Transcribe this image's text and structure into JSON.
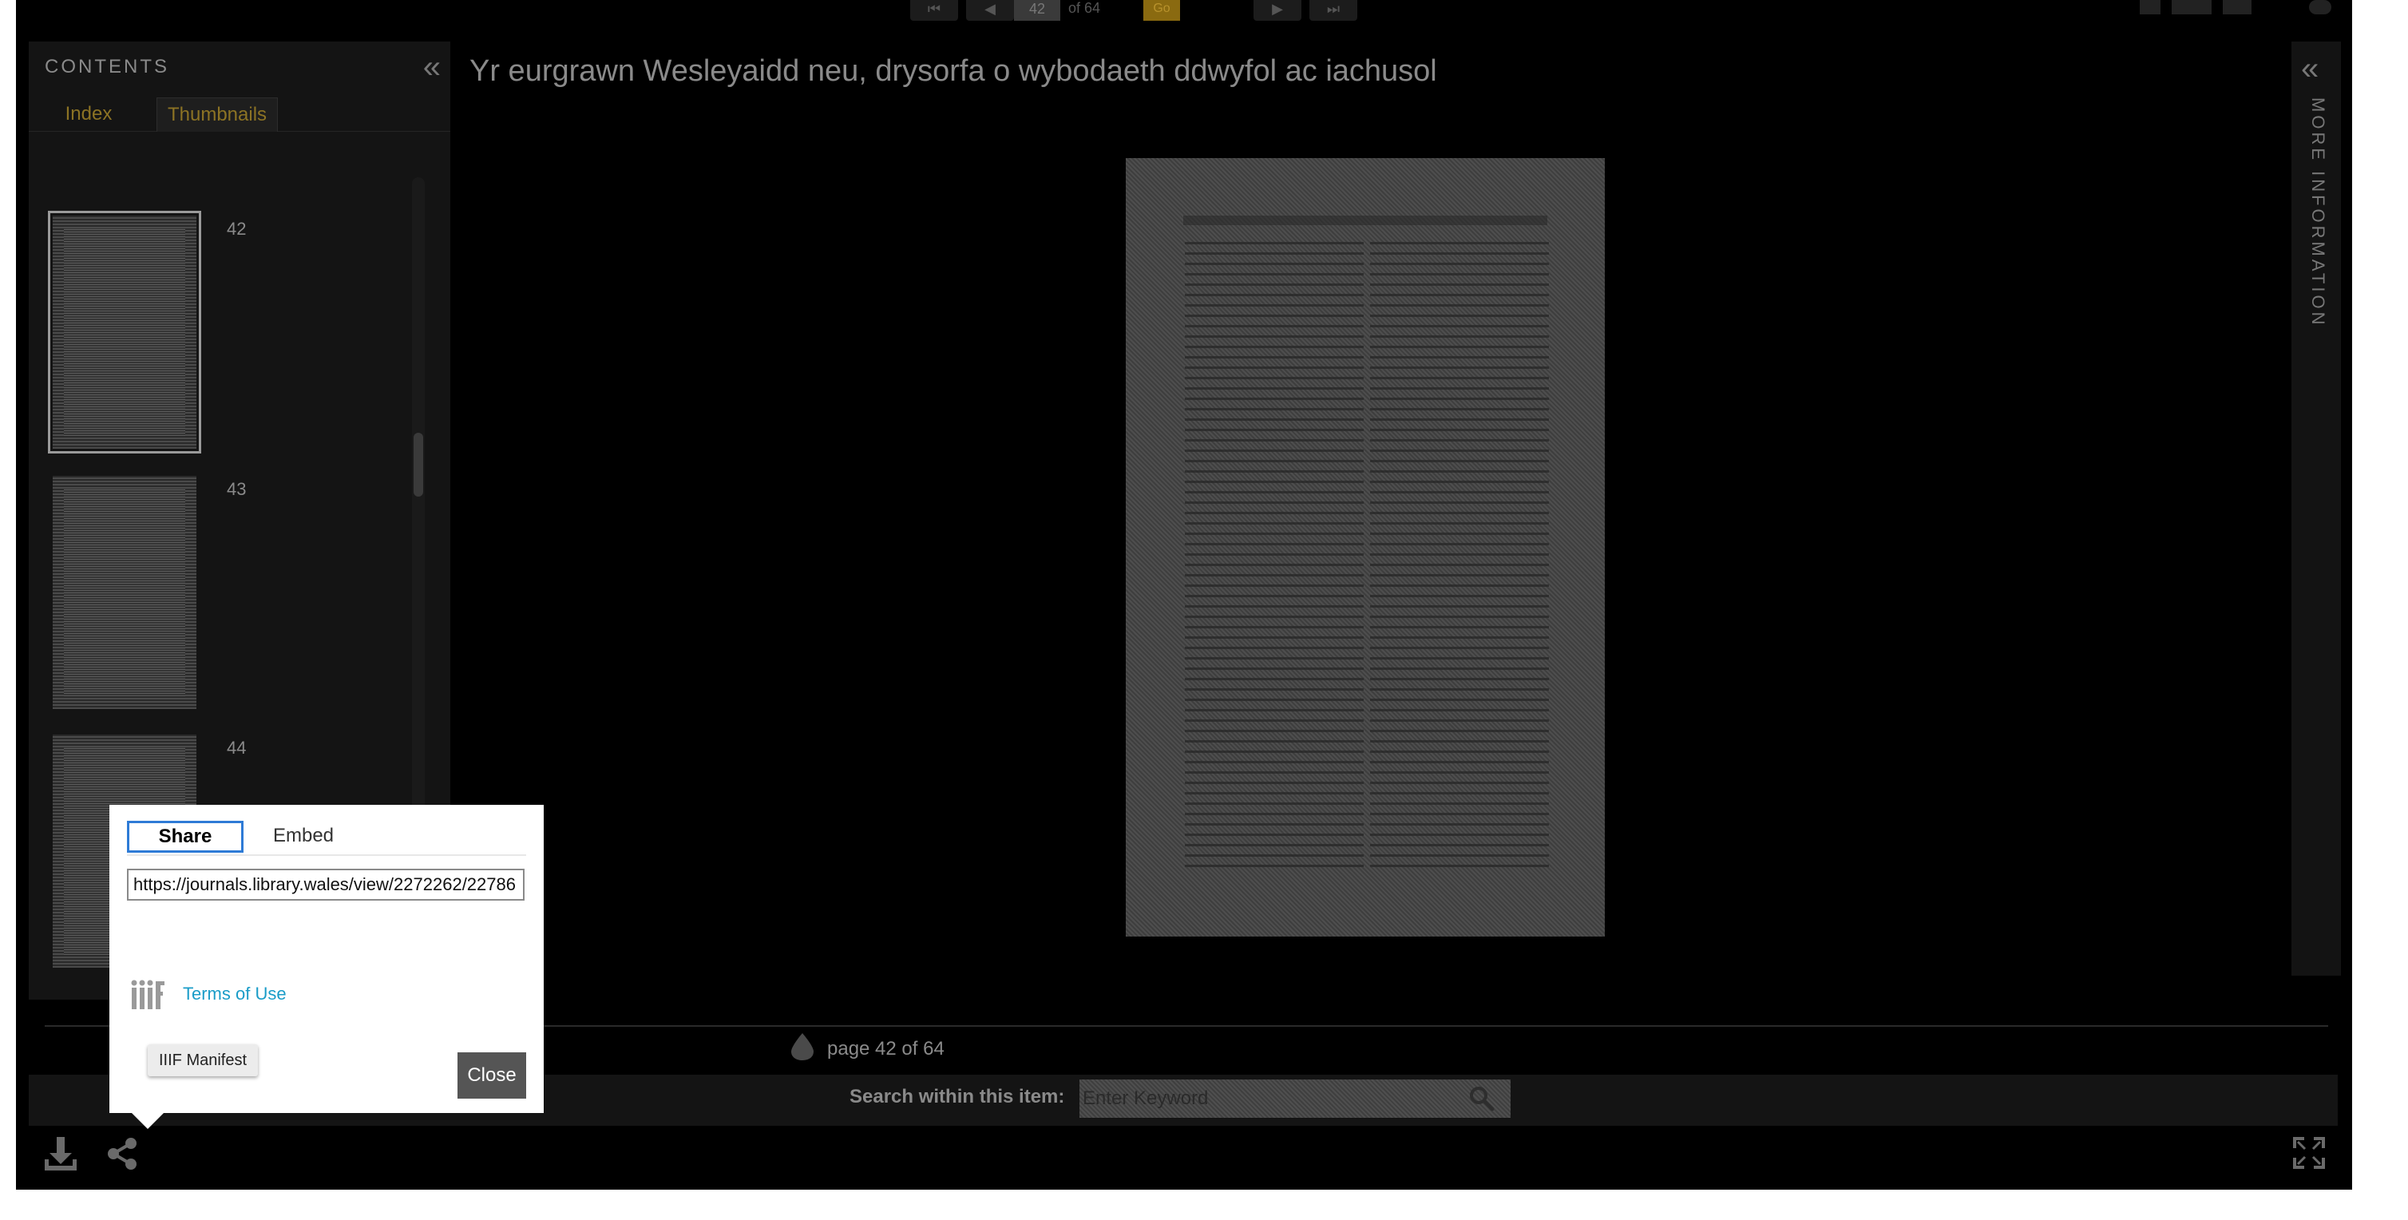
{
  "toolbar": {
    "page_input_value": "42",
    "page_total": "of 64",
    "go_label": "Go"
  },
  "contents": {
    "title": "CONTENTS",
    "tabs": [
      {
        "label": "Index",
        "active": false
      },
      {
        "label": "Thumbnails",
        "active": true
      }
    ],
    "thumbnails": [
      {
        "number": "42",
        "selected": true
      },
      {
        "number": "43",
        "selected": false
      },
      {
        "number": "44",
        "selected": false
      }
    ]
  },
  "document": {
    "title": "Yr eurgrawn Wesleyaidd neu, drysorfa o wybodaeth ddwyfol ac iachusol"
  },
  "more_info": {
    "label": "MORE INFORMATION"
  },
  "status": {
    "page_status": "page 42 of 64"
  },
  "search": {
    "label": "Search within this item:",
    "placeholder": "Enter Keyword"
  },
  "share_popup": {
    "tab_share": "Share",
    "tab_embed": "Embed",
    "url": "https://journals.library.wales/view/2272262/22786",
    "terms_label": "Terms of Use",
    "iiif_manifest_label": "IIIF Manifest",
    "close_label": "Close"
  },
  "colors": {
    "accent_gold": "#8c7324",
    "link_blue": "#1a9cc8",
    "share_tab_border": "#2e7bd6",
    "viewer_background": "#000000"
  }
}
